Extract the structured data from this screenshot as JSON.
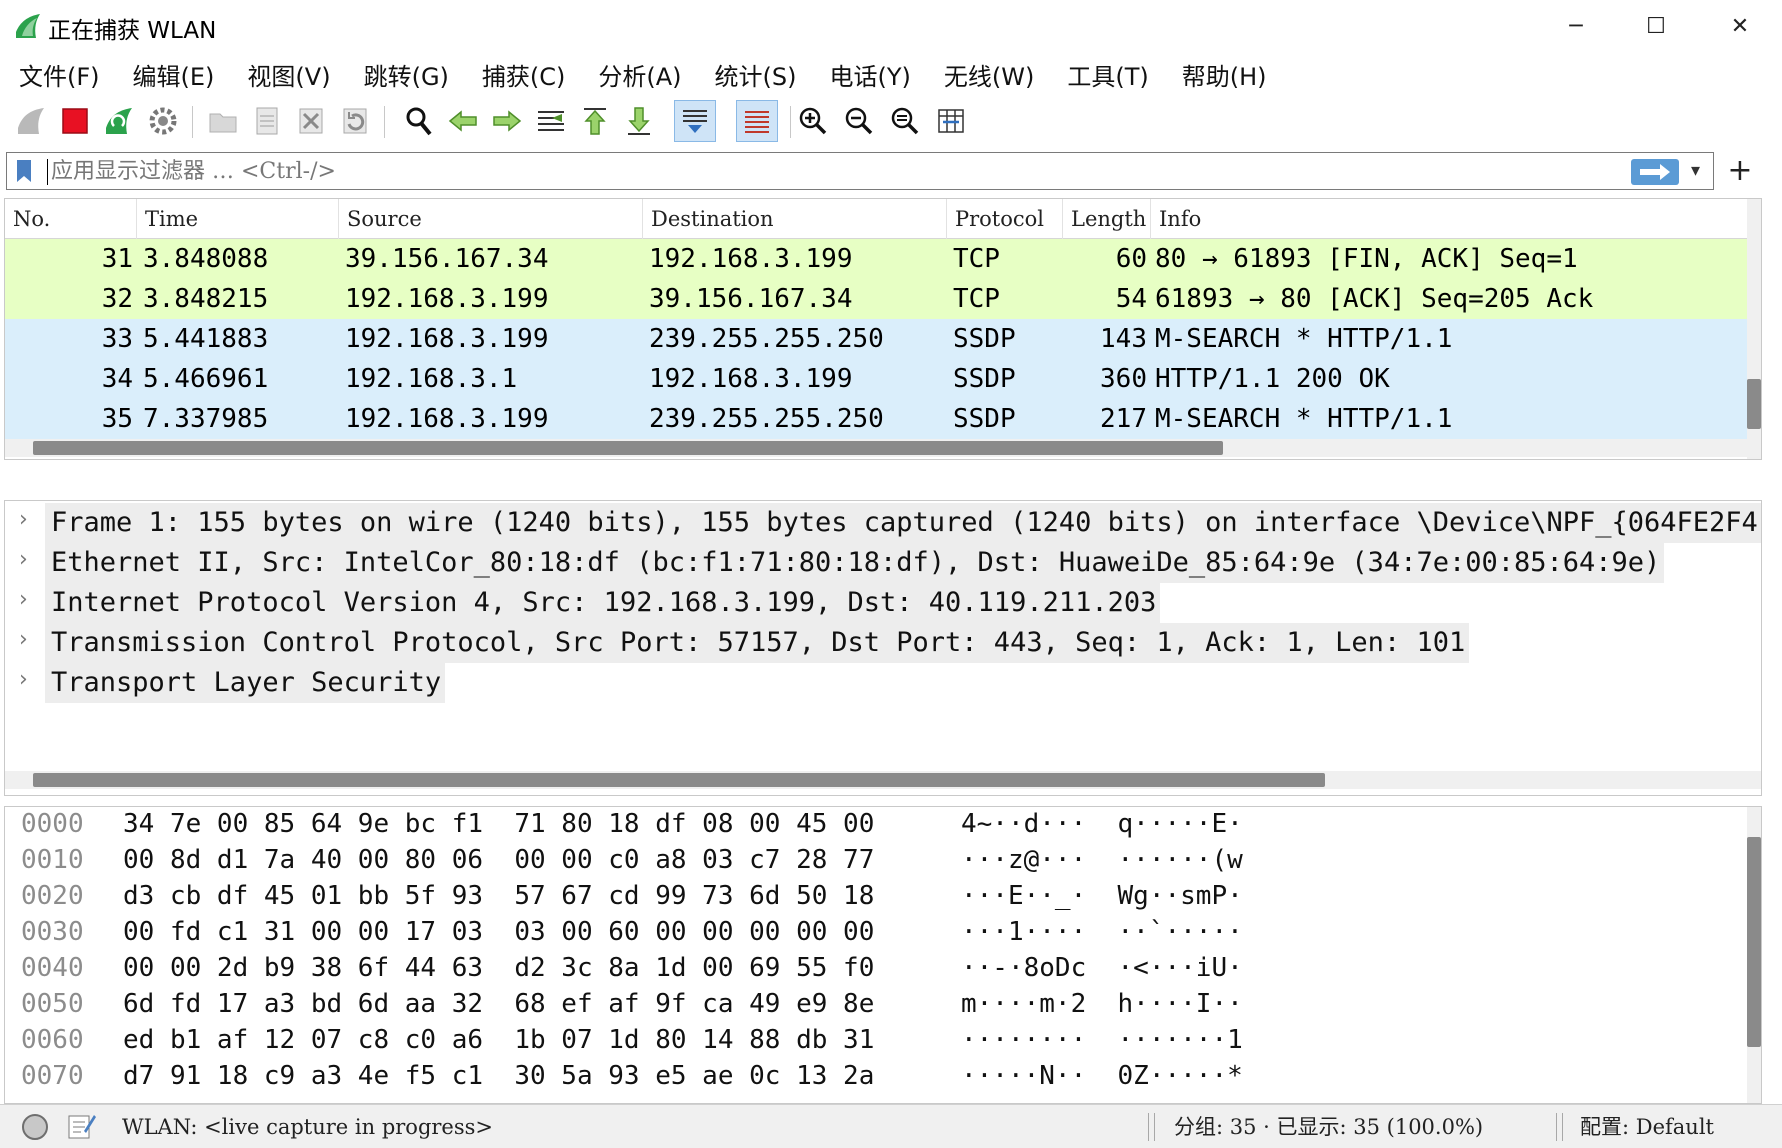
{
  "window": {
    "title": "正在捕获 WLAN",
    "minimize_glyph": "─",
    "maximize_glyph": "☐",
    "close_glyph": "✕",
    "icon": "wireshark-fin-icon"
  },
  "menu": [
    "文件(F)",
    "编辑(E)",
    "视图(V)",
    "跳转(G)",
    "捕获(C)",
    "分析(A)",
    "统计(S)",
    "电话(Y)",
    "无线(W)",
    "工具(T)",
    "帮助(H)"
  ],
  "toolbar": {
    "icons": [
      "start-capture-icon",
      "stop-capture-icon",
      "restart-capture-icon",
      "capture-options-icon",
      "open-file-icon",
      "save-file-icon",
      "close-file-icon",
      "reload-file-icon",
      "find-packet-icon",
      "go-back-icon",
      "go-forward-icon",
      "go-to-packet-icon",
      "first-packet-icon",
      "last-packet-icon",
      "auto-scroll-icon",
      "colorize-icon",
      "zoom-in-icon",
      "zoom-out-icon",
      "normal-size-icon",
      "resize-columns-icon"
    ]
  },
  "filter": {
    "placeholder": "应用显示过滤器 … <Ctrl-/>",
    "value": "",
    "dropdown_glyph": "▾",
    "add_glyph": "+"
  },
  "packet_list": {
    "columns": [
      "No.",
      "Time",
      "Source",
      "Destination",
      "Protocol",
      "Length",
      "Info"
    ],
    "rows": [
      {
        "no": "31",
        "time": "3.848088",
        "source": "39.156.167.34",
        "destination": "192.168.3.199",
        "protocol": "TCP",
        "length": "60",
        "info": "80 → 61893 [FIN, ACK] Seq=1",
        "color": "#e7ffc4"
      },
      {
        "no": "32",
        "time": "3.848215",
        "source": "192.168.3.199",
        "destination": "39.156.167.34",
        "protocol": "TCP",
        "length": "54",
        "info": "61893 → 80 [ACK] Seq=205 Ack",
        "color": "#e7ffc4"
      },
      {
        "no": "33",
        "time": "5.441883",
        "source": "192.168.3.199",
        "destination": "239.255.255.250",
        "protocol": "SSDP",
        "length": "143",
        "info": "M-SEARCH * HTTP/1.1",
        "color": "#daeefb"
      },
      {
        "no": "34",
        "time": "5.466961",
        "source": "192.168.3.1",
        "destination": "192.168.3.199",
        "protocol": "SSDP",
        "length": "360",
        "info": "HTTP/1.1 200 OK",
        "color": "#daeefb"
      },
      {
        "no": "35",
        "time": "7.337985",
        "source": "192.168.3.199",
        "destination": "239.255.255.250",
        "protocol": "SSDP",
        "length": "217",
        "info": "M-SEARCH * HTTP/1.1",
        "color": "#daeefb"
      }
    ]
  },
  "details": {
    "chevron": "›",
    "rows": [
      "Frame 1: 155 bytes on wire (1240 bits), 155 bytes captured (1240 bits) on interface \\Device\\NPF_{064FE2F4",
      "Ethernet II, Src: IntelCor_80:18:df (bc:f1:71:80:18:df), Dst: HuaweiDe_85:64:9e (34:7e:00:85:64:9e)",
      "Internet Protocol Version 4, Src: 192.168.3.199, Dst: 40.119.211.203",
      "Transmission Control Protocol, Src Port: 57157, Dst Port: 443, Seq: 1, Ack: 1, Len: 101",
      "Transport Layer Security"
    ]
  },
  "bytes": [
    {
      "offset": "0000",
      "hex": "34 7e 00 85 64 9e bc f1  71 80 18 df 08 00 45 00",
      "ascii": "4~··d···  q·····E·"
    },
    {
      "offset": "0010",
      "hex": "00 8d d1 7a 40 00 80 06  00 00 c0 a8 03 c7 28 77",
      "ascii": "···z@···  ······(w"
    },
    {
      "offset": "0020",
      "hex": "d3 cb df 45 01 bb 5f 93  57 67 cd 99 73 6d 50 18",
      "ascii": "···E··_·  Wg··smP·"
    },
    {
      "offset": "0030",
      "hex": "00 fd c1 31 00 00 17 03  03 00 60 00 00 00 00 00",
      "ascii": "···1····  ··`·····"
    },
    {
      "offset": "0040",
      "hex": "00 00 2d b9 38 6f 44 63  d2 3c 8a 1d 00 69 55 f0",
      "ascii": "··-·8oDc  ·<···iU·"
    },
    {
      "offset": "0050",
      "hex": "6d fd 17 a3 bd 6d aa 32  68 ef af 9f ca 49 e9 8e",
      "ascii": "m····m·2  h····I··"
    },
    {
      "offset": "0060",
      "hex": "ed b1 af 12 07 c8 c0 a6  1b 07 1d 80 14 88 db 31",
      "ascii": "········  ·······1"
    },
    {
      "offset": "0070",
      "hex": "d7 91 18 c9 a3 4e f5 c1  30 5a 93 e5 ae 0c 13 2a",
      "ascii": "·····N··  0Z·····*"
    }
  ],
  "status": {
    "interface": "WLAN: <live capture in progress>",
    "packets": "分组: 35 · 已显示: 35 (100.0%)",
    "profile": "配置: Default"
  },
  "colors": {
    "tcp_row": "#e7ffc4",
    "udp_row": "#daeefb",
    "stop_red": "#e81123",
    "wireshark_green": "#2ba24c",
    "toolbar_blue": "#2f6fbf"
  }
}
